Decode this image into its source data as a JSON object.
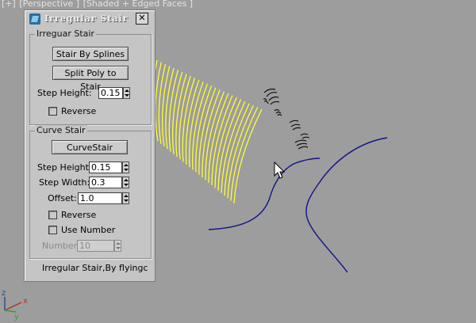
{
  "viewport": {
    "labels": [
      "[+]",
      "[Perspective ]",
      "[Shaded + Edged Faces ]"
    ]
  },
  "dialog": {
    "title": "Irregular Stair",
    "close_glyph": "✕",
    "footer": "Irregular Stair,By flyingc"
  },
  "irregular_group": {
    "legend": "Irreguar Stair",
    "stair_by_splines": "Stair By Splines",
    "split_poly": "Split Poly to Stair",
    "step_height_label": "Step Height:",
    "step_height_value": "0.15",
    "reverse_label": "Reverse"
  },
  "curve_group": {
    "legend": "Curve Stair",
    "curve_stair_button": "CurveStair",
    "step_height_label": "Step Height:",
    "step_height_value": "0.15",
    "step_width_label": "Step Width:",
    "step_width_value": "0.3",
    "offset_label": "Offset:",
    "offset_value": "1.0",
    "reverse_label": "Reverse",
    "use_number_label": "Use Number",
    "number_label": "Number:",
    "number_value": "10"
  },
  "axis": {
    "x": "x",
    "y": "y",
    "z": "z"
  },
  "colors": {
    "viewport_bg": "#9d9d9d",
    "stair_lines": "#ffff33",
    "spline": "#11118a",
    "mini_stair": "#111111"
  },
  "icons": {
    "title": "maxscript-icon",
    "close": "close-icon",
    "cursor": "mouse-cursor-icon",
    "axis": "axis-gizmo-icon"
  }
}
